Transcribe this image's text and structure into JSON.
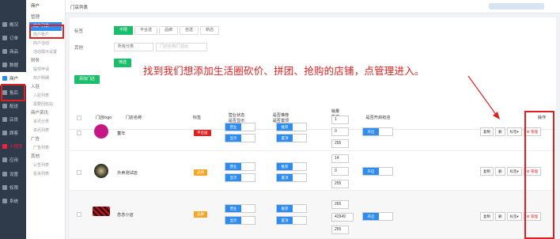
{
  "rail": {
    "items": [
      {
        "label": "概况"
      },
      {
        "label": "订单"
      },
      {
        "label": "商品"
      },
      {
        "label": "数据"
      },
      {
        "label": "商户"
      },
      {
        "label": "售后"
      },
      {
        "label": "配送"
      },
      {
        "label": "店员"
      },
      {
        "label": "顾客"
      },
      {
        "label": "小程序"
      },
      {
        "label": "应用"
      },
      {
        "label": "设置"
      },
      {
        "label": "权限"
      },
      {
        "label": "系统"
      }
    ]
  },
  "topbar": {
    "section": "商户",
    "title": "门店列表"
  },
  "submenu": {
    "groups": [
      {
        "title": "管理",
        "items": [
          "商户列表",
          "商户帐户",
          "商户活动",
          "活动展示设置"
        ]
      },
      {
        "title": "财务",
        "items": [
          "提现申请",
          "商户明细"
        ]
      },
      {
        "title": "入驻",
        "items": [
          "入驻列表",
          "需要回收站"
        ]
      },
      {
        "title": "商户资讯",
        "items": [
          "资讯分类",
          "资讯列表"
        ]
      },
      {
        "title": "广告",
        "items": [
          "广告列表"
        ]
      },
      {
        "title": "其他",
        "items": [
          "公告列表",
          "投诉列表"
        ]
      }
    ],
    "active_item": "商户列表"
  },
  "filters": {
    "tag_label": "标签",
    "tags": [
      "不限",
      "平台送",
      "品牌",
      "自送",
      "新店"
    ],
    "other_label": "其他",
    "category_select": "所有分类",
    "search_placeholder": "门店名称/门店id",
    "search_button": "筛选",
    "add_button": "添加门店"
  },
  "annotation": "找到我们想添加生活圈砍价、拼团、抢购的店铺，点管理进入。",
  "table": {
    "headers": {
      "logo": "门店logo",
      "name": "门店名称",
      "tag": "标签",
      "status": "营业状态\n是否显示",
      "recommend": "是否推荐\n是否置顶",
      "sales": "销量\n热度\n排序",
      "open_service": "是否开启抢店",
      "ops": "操作"
    },
    "rows": [
      {
        "name": "童年",
        "tag": "平台送",
        "tag_color": "#e02020",
        "logo_color": "#c71585",
        "status": "营业",
        "show": "显示",
        "recommend": "推荐",
        "top": "置顶",
        "sales": "1",
        "heat": "0",
        "sort": "255",
        "open": "开启"
      },
      {
        "name": "外卖测试店",
        "tag": "品牌",
        "tag_color": "#f5a623",
        "logo_color": "#3a3a2a",
        "status": "营业",
        "show": "显示",
        "recommend": "推荐",
        "top": "置顶",
        "sales": "14",
        "heat": "0",
        "sort": "255",
        "open": "开启"
      },
      {
        "name": "念念小店",
        "tag": "品牌",
        "tag_color": "#f5a623",
        "logo_color": "#b0161d",
        "status": "营业",
        "show": "显示",
        "recommend": "推荐",
        "top": "置顶",
        "sales": "265",
        "heat": "42949",
        "sort": "255",
        "open": "开启"
      }
    ],
    "ops": {
      "copy": "复制",
      "delete": "删",
      "tag": "标签▾",
      "manage": "⚙ 管理"
    }
  }
}
